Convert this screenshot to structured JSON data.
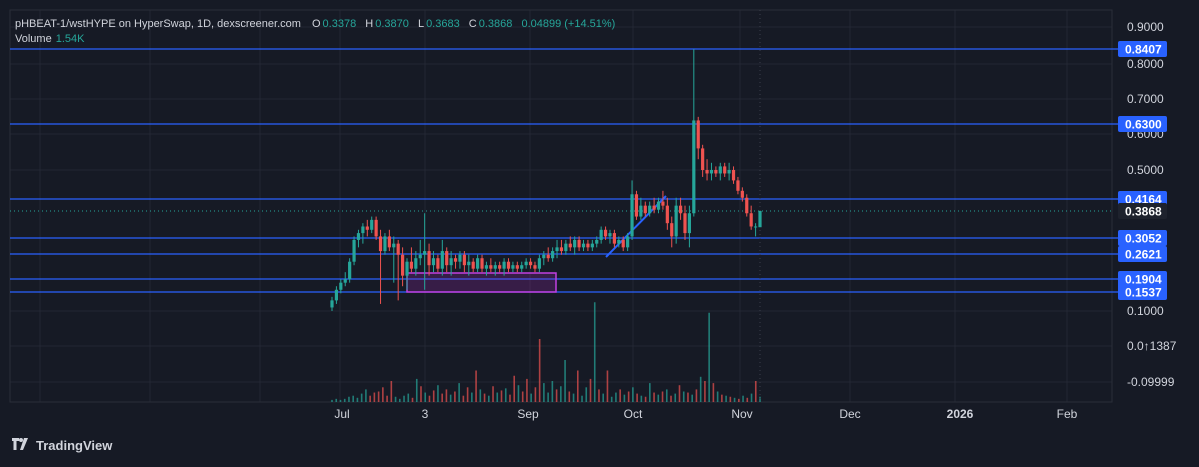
{
  "header": {
    "symbol": "pHBEAT-1/wstHYPE on HyperSwap, 1D, dexscreener.com",
    "o_label": "O",
    "o_value": "0.3378",
    "h_label": "H",
    "h_value": "0.3870",
    "l_label": "L",
    "l_value": "0.3683",
    "c_label": "C",
    "c_value": "0.3868",
    "change": "0.04899 (+14.51%)",
    "volume_label": "Volume",
    "volume_value": "1.54K"
  },
  "footer": {
    "brand": "TradingView",
    "logo_icon": "tradingview-logo-icon"
  },
  "chart_data": {
    "type": "candlestick",
    "y_tick_labels": [
      "0.9000",
      "0.8000",
      "0.7000",
      "0.6000",
      "0.5000",
      "0.1000",
      "0.0↑1387",
      "-0.09999"
    ],
    "y_ticks": [
      {
        "label": "0.9000",
        "value": 0.9
      },
      {
        "label": "0.8000",
        "value": 0.8
      },
      {
        "label": "0.7000",
        "value": 0.7
      },
      {
        "label": "0.6000",
        "value": 0.6
      },
      {
        "label": "0.5000",
        "value": 0.5
      },
      {
        "label": "0.1000",
        "value": 0.1
      },
      {
        "label": "0.0↑1387",
        "value": 0.0
      },
      {
        "label": "-0.09999",
        "value": -0.1
      }
    ],
    "x_tick_labels": [
      "Jul",
      "3",
      "Sep",
      "Oct",
      "Nov",
      "Dec",
      "2026",
      "Feb"
    ],
    "horizontal_levels": [
      {
        "label": "0.8407",
        "value": 0.8407
      },
      {
        "label": "0.6300",
        "value": 0.63
      },
      {
        "label": "0.4164",
        "value": 0.4164
      },
      {
        "label": "0.3052",
        "value": 0.3052
      },
      {
        "label": "0.2621",
        "value": 0.2621
      },
      {
        "label": "0.1904",
        "value": 0.1904
      },
      {
        "label": "0.1537",
        "value": 0.1537
      }
    ],
    "current_price": {
      "label": "0.3868",
      "value": 0.3868
    },
    "colors": {
      "up": "#26a69a",
      "down": "#ef5350",
      "level": "#2962ff",
      "box": "#c040e0",
      "background": "#161a25",
      "grid": "#232733"
    },
    "candles": [
      [
        0.11,
        0.14,
        0.1,
        0.13
      ],
      [
        0.13,
        0.17,
        0.12,
        0.16
      ],
      [
        0.16,
        0.19,
        0.15,
        0.18
      ],
      [
        0.18,
        0.21,
        0.17,
        0.19
      ],
      [
        0.19,
        0.25,
        0.18,
        0.24
      ],
      [
        0.24,
        0.31,
        0.23,
        0.3
      ],
      [
        0.3,
        0.33,
        0.28,
        0.32
      ],
      [
        0.32,
        0.35,
        0.29,
        0.34
      ],
      [
        0.34,
        0.36,
        0.31,
        0.33
      ],
      [
        0.33,
        0.37,
        0.32,
        0.36
      ],
      [
        0.36,
        0.37,
        0.3,
        0.31
      ],
      [
        0.31,
        0.33,
        0.12,
        0.27
      ],
      [
        0.27,
        0.32,
        0.26,
        0.31
      ],
      [
        0.31,
        0.33,
        0.27,
        0.28
      ],
      [
        0.28,
        0.31,
        0.18,
        0.29
      ],
      [
        0.29,
        0.3,
        0.13,
        0.26
      ],
      [
        0.26,
        0.28,
        0.17,
        0.2
      ],
      [
        0.2,
        0.25,
        0.16,
        0.24
      ],
      [
        0.24,
        0.28,
        0.21,
        0.22
      ],
      [
        0.22,
        0.27,
        0.2,
        0.25
      ],
      [
        0.25,
        0.3,
        0.23,
        0.26
      ],
      [
        0.26,
        0.38,
        0.16,
        0.27
      ],
      [
        0.27,
        0.29,
        0.2,
        0.23
      ],
      [
        0.23,
        0.27,
        0.21,
        0.25
      ],
      [
        0.25,
        0.26,
        0.21,
        0.22
      ],
      [
        0.22,
        0.3,
        0.2,
        0.27
      ],
      [
        0.27,
        0.28,
        0.21,
        0.23
      ],
      [
        0.23,
        0.27,
        0.2,
        0.25
      ],
      [
        0.25,
        0.26,
        0.22,
        0.24
      ],
      [
        0.24,
        0.27,
        0.22,
        0.26
      ],
      [
        0.26,
        0.27,
        0.21,
        0.23
      ],
      [
        0.23,
        0.26,
        0.2,
        0.24
      ],
      [
        0.24,
        0.25,
        0.21,
        0.22
      ],
      [
        0.22,
        0.26,
        0.21,
        0.25
      ],
      [
        0.25,
        0.26,
        0.21,
        0.22
      ],
      [
        0.22,
        0.24,
        0.2,
        0.23
      ],
      [
        0.23,
        0.25,
        0.21,
        0.22
      ],
      [
        0.22,
        0.24,
        0.2,
        0.23
      ],
      [
        0.23,
        0.24,
        0.21,
        0.22
      ],
      [
        0.22,
        0.25,
        0.2,
        0.24
      ],
      [
        0.24,
        0.25,
        0.21,
        0.22
      ],
      [
        0.22,
        0.24,
        0.21,
        0.23
      ],
      [
        0.23,
        0.24,
        0.21,
        0.22
      ],
      [
        0.22,
        0.24,
        0.21,
        0.23
      ],
      [
        0.23,
        0.25,
        0.22,
        0.24
      ],
      [
        0.24,
        0.25,
        0.22,
        0.23
      ],
      [
        0.23,
        0.24,
        0.21,
        0.22
      ],
      [
        0.22,
        0.26,
        0.21,
        0.25
      ],
      [
        0.25,
        0.27,
        0.23,
        0.26
      ],
      [
        0.26,
        0.28,
        0.24,
        0.25
      ],
      [
        0.25,
        0.28,
        0.24,
        0.27
      ],
      [
        0.27,
        0.3,
        0.25,
        0.28
      ],
      [
        0.28,
        0.3,
        0.26,
        0.27
      ],
      [
        0.27,
        0.3,
        0.26,
        0.29
      ],
      [
        0.29,
        0.31,
        0.27,
        0.28
      ],
      [
        0.28,
        0.31,
        0.26,
        0.3
      ],
      [
        0.3,
        0.31,
        0.27,
        0.28
      ],
      [
        0.28,
        0.3,
        0.27,
        0.29
      ],
      [
        0.29,
        0.3,
        0.27,
        0.28
      ],
      [
        0.28,
        0.3,
        0.27,
        0.29
      ],
      [
        0.29,
        0.31,
        0.28,
        0.3
      ],
      [
        0.3,
        0.34,
        0.29,
        0.33
      ],
      [
        0.33,
        0.34,
        0.3,
        0.31
      ],
      [
        0.31,
        0.33,
        0.29,
        0.32
      ],
      [
        0.32,
        0.33,
        0.28,
        0.29
      ],
      [
        0.29,
        0.31,
        0.28,
        0.3
      ],
      [
        0.3,
        0.31,
        0.27,
        0.28
      ],
      [
        0.28,
        0.32,
        0.27,
        0.31
      ],
      [
        0.31,
        0.47,
        0.3,
        0.43
      ],
      [
        0.43,
        0.44,
        0.36,
        0.37
      ],
      [
        0.37,
        0.42,
        0.36,
        0.4
      ],
      [
        0.4,
        0.41,
        0.37,
        0.38
      ],
      [
        0.38,
        0.41,
        0.37,
        0.4
      ],
      [
        0.4,
        0.42,
        0.38,
        0.39
      ],
      [
        0.39,
        0.42,
        0.38,
        0.41
      ],
      [
        0.41,
        0.44,
        0.39,
        0.4
      ],
      [
        0.4,
        0.42,
        0.33,
        0.35
      ],
      [
        0.35,
        0.37,
        0.28,
        0.31
      ],
      [
        0.31,
        0.42,
        0.29,
        0.4
      ],
      [
        0.4,
        0.42,
        0.36,
        0.38
      ],
      [
        0.38,
        0.4,
        0.3,
        0.32
      ],
      [
        0.32,
        0.4,
        0.28,
        0.38
      ],
      [
        0.38,
        0.84,
        0.37,
        0.64
      ],
      [
        0.64,
        0.65,
        0.53,
        0.56
      ],
      [
        0.56,
        0.57,
        0.48,
        0.5
      ],
      [
        0.5,
        0.53,
        0.47,
        0.49
      ],
      [
        0.49,
        0.52,
        0.47,
        0.5
      ],
      [
        0.5,
        0.51,
        0.48,
        0.49
      ],
      [
        0.49,
        0.52,
        0.47,
        0.51
      ],
      [
        0.51,
        0.52,
        0.48,
        0.49
      ],
      [
        0.49,
        0.52,
        0.47,
        0.5
      ],
      [
        0.5,
        0.51,
        0.46,
        0.47
      ],
      [
        0.47,
        0.48,
        0.43,
        0.44
      ],
      [
        0.44,
        0.45,
        0.41,
        0.42
      ],
      [
        0.42,
        0.43,
        0.37,
        0.38
      ],
      [
        0.38,
        0.4,
        0.33,
        0.34
      ],
      [
        0.34,
        0.35,
        0.31,
        0.34
      ],
      [
        0.3378,
        0.387,
        0.3683,
        0.3868
      ]
    ],
    "volumes": [
      [
        2,
        1
      ],
      [
        3,
        1
      ],
      [
        2,
        1
      ],
      [
        3,
        1
      ],
      [
        5,
        1
      ],
      [
        6,
        1
      ],
      [
        4,
        1
      ],
      [
        8,
        1
      ],
      [
        12,
        1
      ],
      [
        6,
        0
      ],
      [
        9,
        0
      ],
      [
        10,
        0
      ],
      [
        14,
        0
      ],
      [
        6,
        0
      ],
      [
        20,
        0
      ],
      [
        5,
        1
      ],
      [
        3,
        1
      ],
      [
        6,
        1
      ],
      [
        8,
        1
      ],
      [
        4,
        0
      ],
      [
        22,
        1
      ],
      [
        15,
        0
      ],
      [
        9,
        1
      ],
      [
        6,
        0
      ],
      [
        11,
        0
      ],
      [
        16,
        1
      ],
      [
        8,
        0
      ],
      [
        12,
        0
      ],
      [
        7,
        1
      ],
      [
        10,
        0
      ],
      [
        18,
        1
      ],
      [
        6,
        0
      ],
      [
        14,
        0
      ],
      [
        9,
        1
      ],
      [
        30,
        0
      ],
      [
        12,
        1
      ],
      [
        8,
        0
      ],
      [
        6,
        1
      ],
      [
        15,
        0
      ],
      [
        9,
        1
      ],
      [
        11,
        0
      ],
      [
        13,
        1
      ],
      [
        7,
        0
      ],
      [
        25,
        0
      ],
      [
        16,
        1
      ],
      [
        10,
        0
      ],
      [
        22,
        0
      ],
      [
        8,
        1
      ],
      [
        14,
        0
      ],
      [
        60,
        0
      ],
      [
        18,
        1
      ],
      [
        9,
        1
      ],
      [
        20,
        1
      ],
      [
        12,
        0
      ],
      [
        15,
        1
      ],
      [
        40,
        1
      ],
      [
        10,
        0
      ],
      [
        8,
        1
      ],
      [
        30,
        0
      ],
      [
        6,
        1
      ],
      [
        14,
        1
      ],
      [
        22,
        0
      ],
      [
        95,
        1
      ],
      [
        12,
        0
      ],
      [
        8,
        1
      ],
      [
        30,
        0
      ],
      [
        5,
        1
      ],
      [
        9,
        1
      ],
      [
        12,
        0
      ],
      [
        7,
        1
      ],
      [
        10,
        0
      ],
      [
        14,
        1
      ],
      [
        8,
        0
      ],
      [
        6,
        1
      ],
      [
        5,
        0
      ],
      [
        18,
        1
      ],
      [
        9,
        0
      ],
      [
        7,
        1
      ],
      [
        10,
        0
      ],
      [
        12,
        1
      ],
      [
        6,
        0
      ],
      [
        8,
        1
      ],
      [
        16,
        0
      ],
      [
        10,
        1
      ],
      [
        9,
        0
      ],
      [
        7,
        1
      ],
      [
        12,
        0
      ],
      [
        24,
        1
      ],
      [
        20,
        0
      ],
      [
        85,
        1
      ],
      [
        18,
        0
      ],
      [
        10,
        1
      ],
      [
        7,
        0
      ],
      [
        6,
        1
      ],
      [
        5,
        0
      ],
      [
        4,
        1
      ],
      [
        3,
        0
      ],
      [
        6,
        1
      ],
      [
        4,
        0
      ],
      [
        8,
        1
      ],
      [
        20,
        0
      ],
      [
        5,
        1
      ]
    ]
  }
}
